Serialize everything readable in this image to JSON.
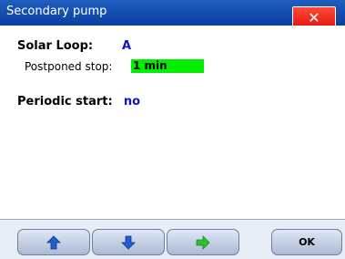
{
  "window": {
    "title": "Secondary pump",
    "close_label": "✕"
  },
  "fields": {
    "solar_loop_label": "Solar Loop:",
    "solar_loop_value": "A",
    "postponed_stop_label": "Postponed stop:",
    "postponed_stop_value": "1 min",
    "periodic_start_label": "Periodic start:",
    "periodic_start_value": "no"
  },
  "toolbar": {
    "up_icon": "arrow-up-icon",
    "down_icon": "arrow-down-icon",
    "right_icon": "arrow-right-icon",
    "ok_label": "OK"
  },
  "colors": {
    "title_bar": "#0a3fa0",
    "close": "#e0120a",
    "highlight": "#00ee00",
    "value_text": "#1010d0",
    "right_arrow": "#2fbf2f",
    "nav_arrow": "#1f5fd0"
  }
}
